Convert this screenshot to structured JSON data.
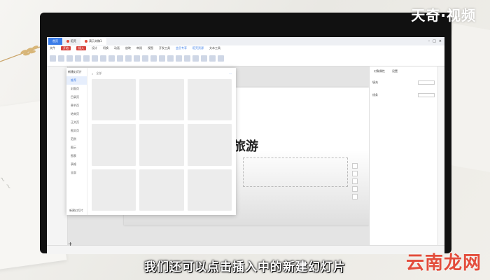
{
  "watermark": {
    "top": "天奇·视频",
    "bottom": "云南龙网"
  },
  "caption": "我们还可以点击插入中的新建幻灯片",
  "app": {
    "tabs": [
      {
        "label": "首页"
      },
      {
        "label": "稻壳"
      },
      {
        "label": "演示文稿1"
      }
    ],
    "menu": [
      "文件",
      "开始",
      "插入",
      "设计",
      "切换",
      "动画",
      "放映",
      "审阅",
      "视图",
      "开发工具",
      "会员专享",
      "稻壳资源",
      "文本工具"
    ],
    "slide": {
      "title": "旅游"
    },
    "popup": {
      "header": "新建幻灯片",
      "items": [
        "推荐",
        "封面页",
        "目录页",
        "章节页",
        "结束页",
        "正文页",
        "图文页",
        "范例",
        "图示",
        "图表",
        "表格",
        "全部"
      ],
      "filter": "全部",
      "footer": "新建幻灯片"
    },
    "rpanel": {
      "tabs": [
        "对象属性",
        "设置"
      ],
      "row1": "填充",
      "row2": "线条"
    }
  }
}
